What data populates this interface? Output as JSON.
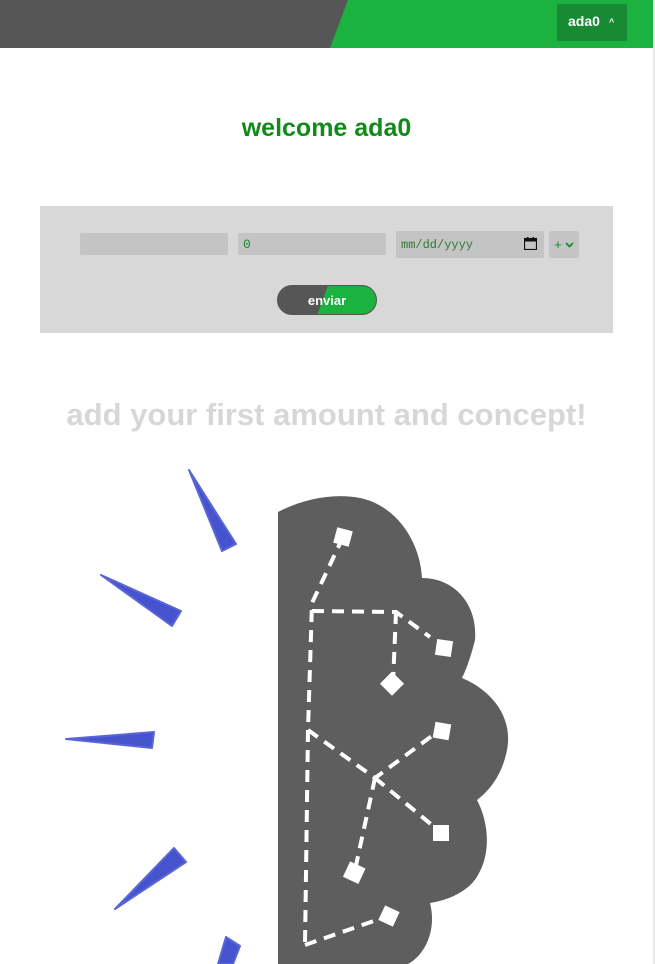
{
  "header": {
    "user_name": "ada0",
    "caret": "^"
  },
  "welcome": "welcome ada0",
  "form": {
    "concept_placeholder": "",
    "amount_value": "0",
    "date_placeholder": "mm/dd/yyyy",
    "sign_value": "+",
    "send_label": "enviar"
  },
  "empty_state": {
    "message": "add your first amount and concept!"
  },
  "colors": {
    "brand_green": "#1bb240",
    "dark_gray": "#565656",
    "accent_blue": "#4653cf"
  }
}
